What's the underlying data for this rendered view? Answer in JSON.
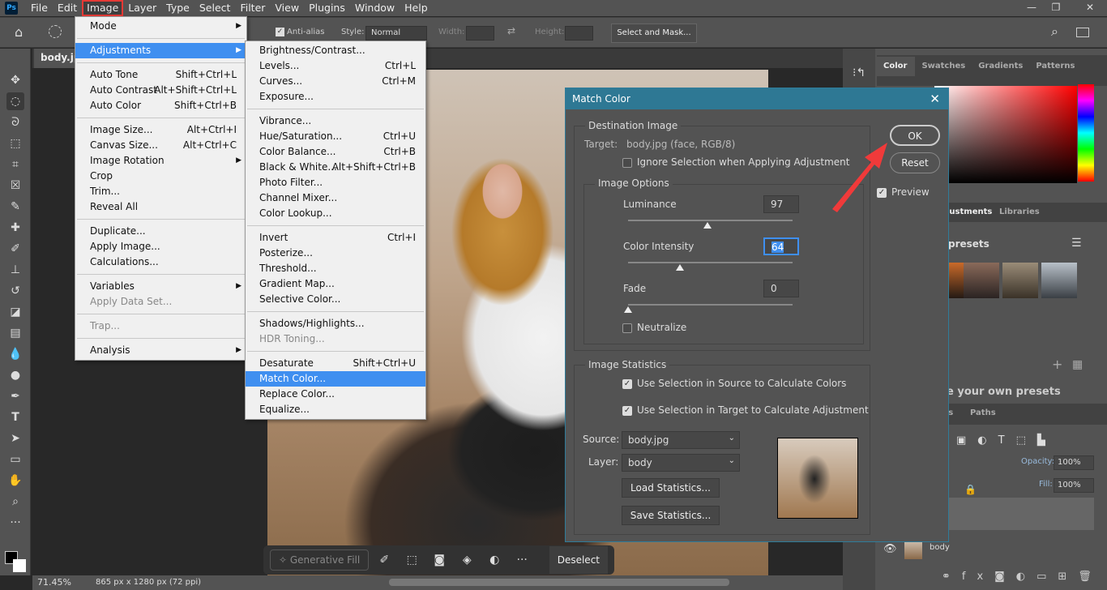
{
  "app": {
    "logo": "Ps"
  },
  "menubar": [
    "File",
    "Edit",
    "Image",
    "Layer",
    "Type",
    "Select",
    "Filter",
    "View",
    "Plugins",
    "Window",
    "Help"
  ],
  "window_controls": {
    "minimize": "—",
    "restore": "❐",
    "close": "✕"
  },
  "options_bar": {
    "anti_alias": "Anti-alias",
    "style_label": "Style:",
    "style_value": "Normal",
    "width_label": "Width:",
    "height_label": "Height:",
    "select_mask": "Select and Mask..."
  },
  "document": {
    "tab": "body.jp",
    "zoom": "71.45%",
    "info": "865 px x 1280 px (72 ppi)"
  },
  "image_menu": [
    {
      "label": "Mode",
      "arrow": true
    },
    {
      "sep": true
    },
    {
      "label": "Adjustments",
      "arrow": true,
      "selected": true
    },
    {
      "sep": true
    },
    {
      "label": "Auto Tone",
      "sc": "Shift+Ctrl+L"
    },
    {
      "label": "Auto Contrast",
      "sc": "Alt+Shift+Ctrl+L"
    },
    {
      "label": "Auto Color",
      "sc": "Shift+Ctrl+B"
    },
    {
      "sep": true
    },
    {
      "label": "Image Size...",
      "sc": "Alt+Ctrl+I"
    },
    {
      "label": "Canvas Size...",
      "sc": "Alt+Ctrl+C"
    },
    {
      "label": "Image Rotation",
      "arrow": true
    },
    {
      "label": "Crop"
    },
    {
      "label": "Trim..."
    },
    {
      "label": "Reveal All"
    },
    {
      "sep": true
    },
    {
      "label": "Duplicate..."
    },
    {
      "label": "Apply Image..."
    },
    {
      "label": "Calculations..."
    },
    {
      "sep": true
    },
    {
      "label": "Variables",
      "arrow": true
    },
    {
      "label": "Apply Data Set...",
      "disabled": true
    },
    {
      "sep": true
    },
    {
      "label": "Trap...",
      "disabled": true
    },
    {
      "sep": true
    },
    {
      "label": "Analysis",
      "arrow": true
    }
  ],
  "adjustments_menu": [
    {
      "label": "Brightness/Contrast..."
    },
    {
      "label": "Levels...",
      "sc": "Ctrl+L"
    },
    {
      "label": "Curves...",
      "sc": "Ctrl+M"
    },
    {
      "label": "Exposure..."
    },
    {
      "sep": true
    },
    {
      "label": "Vibrance..."
    },
    {
      "label": "Hue/Saturation...",
      "sc": "Ctrl+U"
    },
    {
      "label": "Color Balance...",
      "sc": "Ctrl+B"
    },
    {
      "label": "Black & White...",
      "sc": "Alt+Shift+Ctrl+B"
    },
    {
      "label": "Photo Filter..."
    },
    {
      "label": "Channel Mixer..."
    },
    {
      "label": "Color Lookup..."
    },
    {
      "sep": true
    },
    {
      "label": "Invert",
      "sc": "Ctrl+I"
    },
    {
      "label": "Posterize..."
    },
    {
      "label": "Threshold..."
    },
    {
      "label": "Gradient Map..."
    },
    {
      "label": "Selective Color..."
    },
    {
      "sep": true
    },
    {
      "label": "Shadows/Highlights..."
    },
    {
      "label": "HDR Toning...",
      "disabled": true
    },
    {
      "sep": true
    },
    {
      "label": "Desaturate",
      "sc": "Shift+Ctrl+U"
    },
    {
      "label": "Match Color...",
      "selected": true
    },
    {
      "label": "Replace Color..."
    },
    {
      "label": "Equalize..."
    }
  ],
  "dialog": {
    "title": "Match Color",
    "destination": "Destination Image",
    "target_label": "Target:",
    "target_value": "body.jpg (face, RGB/8)",
    "ignore_selection": "Ignore Selection when Applying Adjustment",
    "image_options": "Image Options",
    "luminance_label": "Luminance",
    "luminance": 97,
    "luminance_range": [
      1,
      200
    ],
    "intensity_label": "Color Intensity",
    "intensity": 64,
    "intensity_range": [
      1,
      200
    ],
    "fade_label": "Fade",
    "fade": 0,
    "fade_range": [
      0,
      100
    ],
    "neutralize": "Neutralize",
    "statistics": "Image Statistics",
    "use_source": "Use Selection in Source to Calculate Colors",
    "use_target": "Use Selection in Target to Calculate Adjustment",
    "source_label": "Source:",
    "source_value": "body.jpg",
    "layer_label": "Layer:",
    "layer_value": "body",
    "load": "Load Statistics...",
    "save": "Save Statistics...",
    "ok": "OK",
    "reset": "Reset",
    "preview": "Preview",
    "ignore_checked": false,
    "neutralize_checked": false,
    "use_source_checked": true,
    "use_target_checked": true,
    "preview_checked": true
  },
  "right_panel": {
    "tabs": [
      "Color",
      "Swatches",
      "Gradients",
      "Patterns"
    ],
    "adj_tabs": [
      "justments",
      "Libraries"
    ],
    "presets": "presets",
    "create_presets": "e your own presets",
    "layer_tabs": [
      "els",
      "Paths"
    ],
    "opacity_label": "Opacity:",
    "opacity": "100%",
    "fill_label": "Fill:",
    "fill": "100%",
    "layer_name": "body"
  },
  "context_bar": {
    "generative_fill": "Generative Fill",
    "deselect": "Deselect"
  },
  "colors": {
    "accent": "#3f8ff0",
    "dialog_title": "#2e7894",
    "arrow": "#f03a3a"
  }
}
